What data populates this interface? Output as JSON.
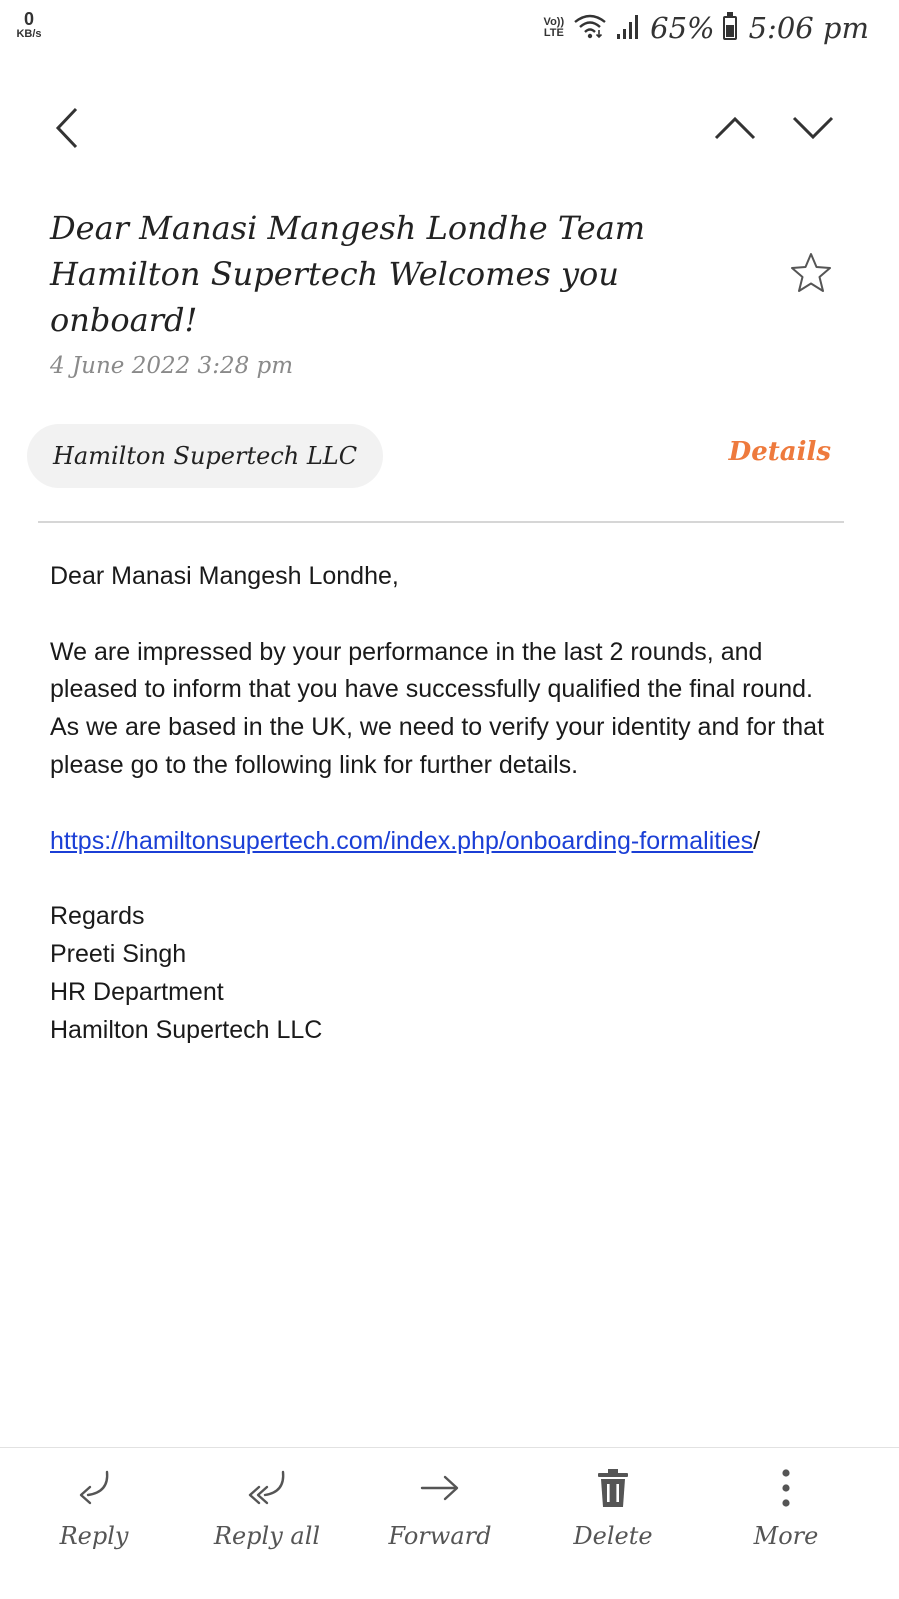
{
  "status_bar": {
    "data_speed_value": "0",
    "data_speed_unit": "KB/s",
    "volte_top": "Vo))",
    "volte_bottom": "LTE",
    "battery": "65%",
    "time": "5:06 pm"
  },
  "email": {
    "subject": "Dear Manasi Mangesh Londhe Team Hamilton Supertech Welcomes you onboard!",
    "date": "4 June 2022 3:28 pm",
    "sender": "Hamilton Supertech LLC",
    "details_label": "Details",
    "greeting": "Dear Manasi Mangesh Londhe,",
    "paragraph": "We are impressed by your performance in the last 2 rounds, and pleased to inform that you have successfully qualified the final round. As we are based in the UK, we need to verify your identity and for that please go to the following link for further details.",
    "link": "https://hamiltonsupertech.com/index.php/onboarding-formalities",
    "link_trailing": "/",
    "signature": {
      "closing": "Regards",
      "name": "Preeti Singh",
      "department": "HR Department",
      "company": "Hamilton Supertech LLC"
    }
  },
  "actions": [
    {
      "label": "Reply",
      "icon": "reply-icon"
    },
    {
      "label": "Reply all",
      "icon": "reply-all-icon"
    },
    {
      "label": "Forward",
      "icon": "forward-icon"
    },
    {
      "label": "Delete",
      "icon": "trash-icon"
    },
    {
      "label": "More",
      "icon": "more-vertical-icon"
    }
  ],
  "colors": {
    "accent": "#ee7a3d",
    "link": "#1b3fd6"
  }
}
